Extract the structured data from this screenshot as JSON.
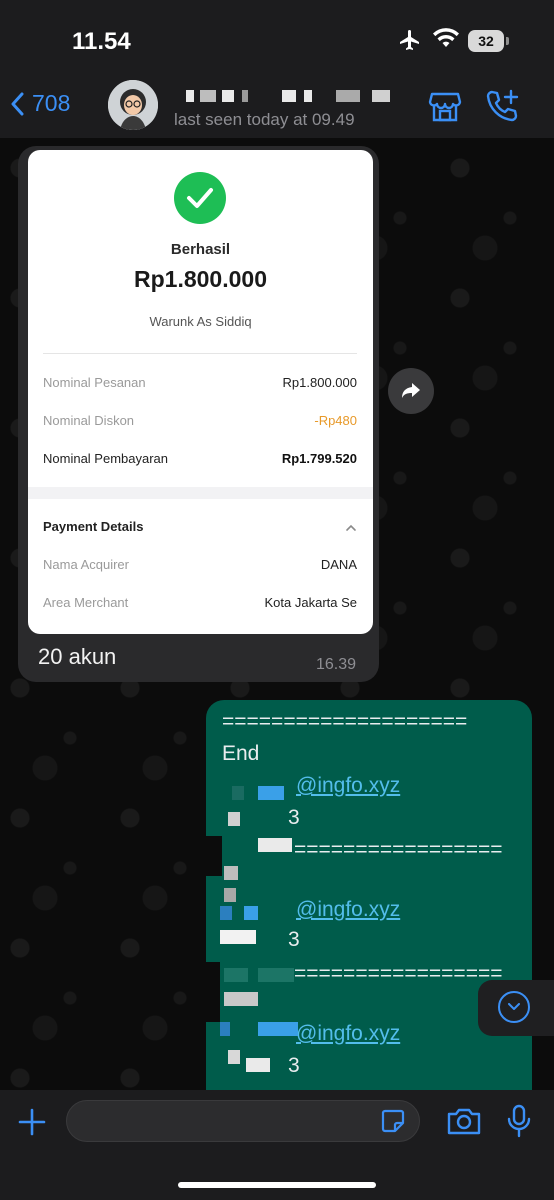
{
  "status_bar": {
    "time": "11.54",
    "battery": "32",
    "icons": [
      "airplane-icon",
      "wifi-icon",
      "battery-icon"
    ]
  },
  "header": {
    "back_count": "708",
    "contact_name": "",
    "last_seen": "last seen today at 09.49",
    "icons": [
      "back-chevron-icon",
      "store-icon",
      "call-add-icon"
    ]
  },
  "receipt": {
    "status": "Berhasil",
    "amount": "Rp1.800.000",
    "merchant": "Warunk As Siddiq",
    "rows": [
      {
        "label": "Nominal Pesanan",
        "value": "Rp1.800.000"
      },
      {
        "label": "Nominal Diskon",
        "value": "-Rp480"
      },
      {
        "label": "Nominal Pembayaran",
        "value": "Rp1.799.520"
      }
    ],
    "payment_details": {
      "title": "Payment Details",
      "rows": [
        {
          "label": "Nama Acquirer",
          "value": "DANA"
        },
        {
          "label": "Area Merchant",
          "value": "Kota Jakarta Se"
        }
      ]
    },
    "colors": {
      "success": "#1ebe55",
      "discount": "#e89a2a"
    }
  },
  "incoming_message": {
    "text": "20 akun",
    "time": "16.39"
  },
  "outgoing_message": {
    "lines": [
      "====================",
      "End",
      "@ingfo.xyz",
      "3",
      "=================",
      "@ingfo.xyz",
      "3",
      "=================",
      "@ingfo.xyz",
      "3"
    ]
  },
  "input_bar": {
    "placeholder": "",
    "icons": [
      "plus-icon",
      "sticker-icon",
      "camera-icon",
      "mic-icon"
    ]
  },
  "colors": {
    "accent": "#3b8ff5",
    "outgoing_bubble": "#005c4b",
    "link": "#53bdeb"
  }
}
